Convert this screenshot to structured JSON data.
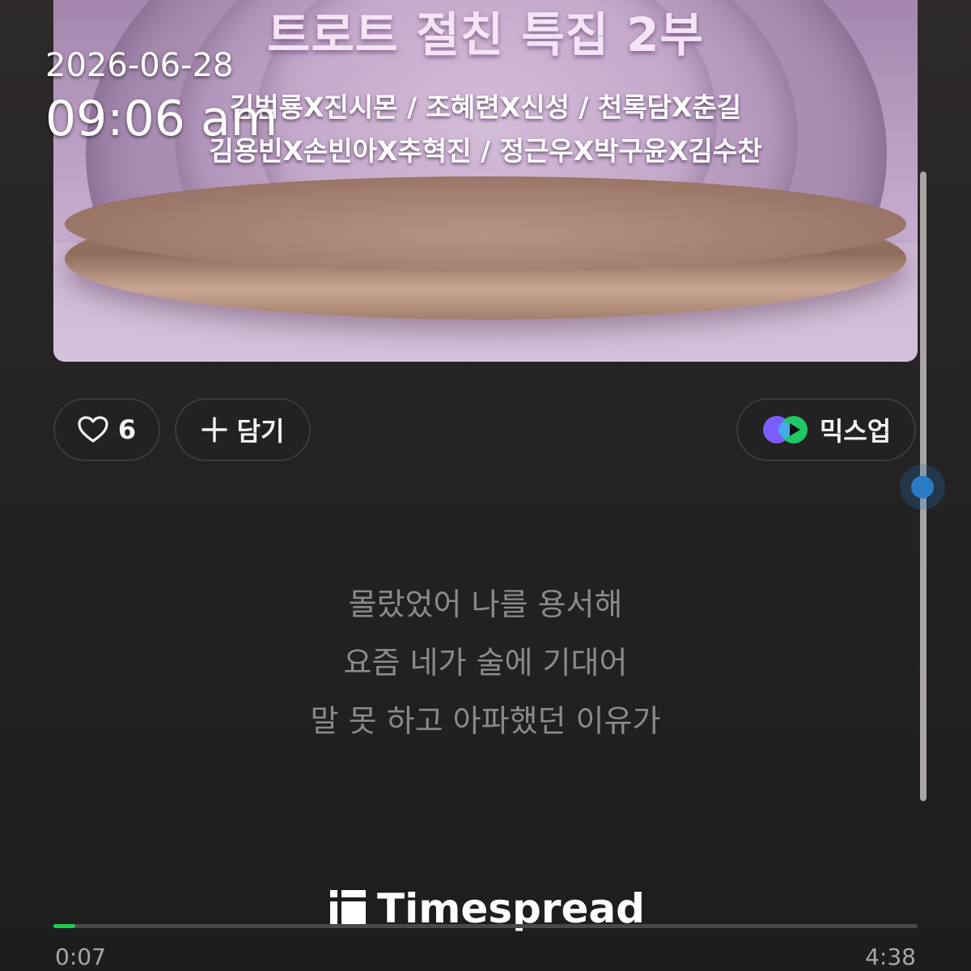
{
  "album_art": {
    "title": "트로트 절친 특집 2부",
    "lines": [
      "김범룡X진시몬 / 조혜련X신성 / 천록담X춘길",
      "김용빈X손빈아X추혁진 / 정근우X박구윤X김수찬"
    ]
  },
  "timestamp": {
    "date": "2026-06-28",
    "time": "09:06 am"
  },
  "actions": {
    "like_count": "6",
    "add_label": "담기",
    "mixup_label": "믹스업"
  },
  "lyrics": [
    "몰랐었어 나를 용서해",
    "요즘 네가 술에 기대어",
    "말 못 하고 아파했던 이유가"
  ],
  "watermark": {
    "text": "Timespread"
  },
  "player": {
    "current_time": "0:07",
    "total_time": "4:38",
    "progress_fraction": 0.025
  },
  "icons": {
    "like": "heart-outline-icon",
    "add": "plus-icon",
    "mixup": "mixup-play-icon",
    "watermark": "timespread-logo-icon"
  },
  "colors": {
    "accent_green": "#19d04a",
    "scroll_thumb": "#2a7bc4",
    "lyric_text": "#8c8a89"
  }
}
